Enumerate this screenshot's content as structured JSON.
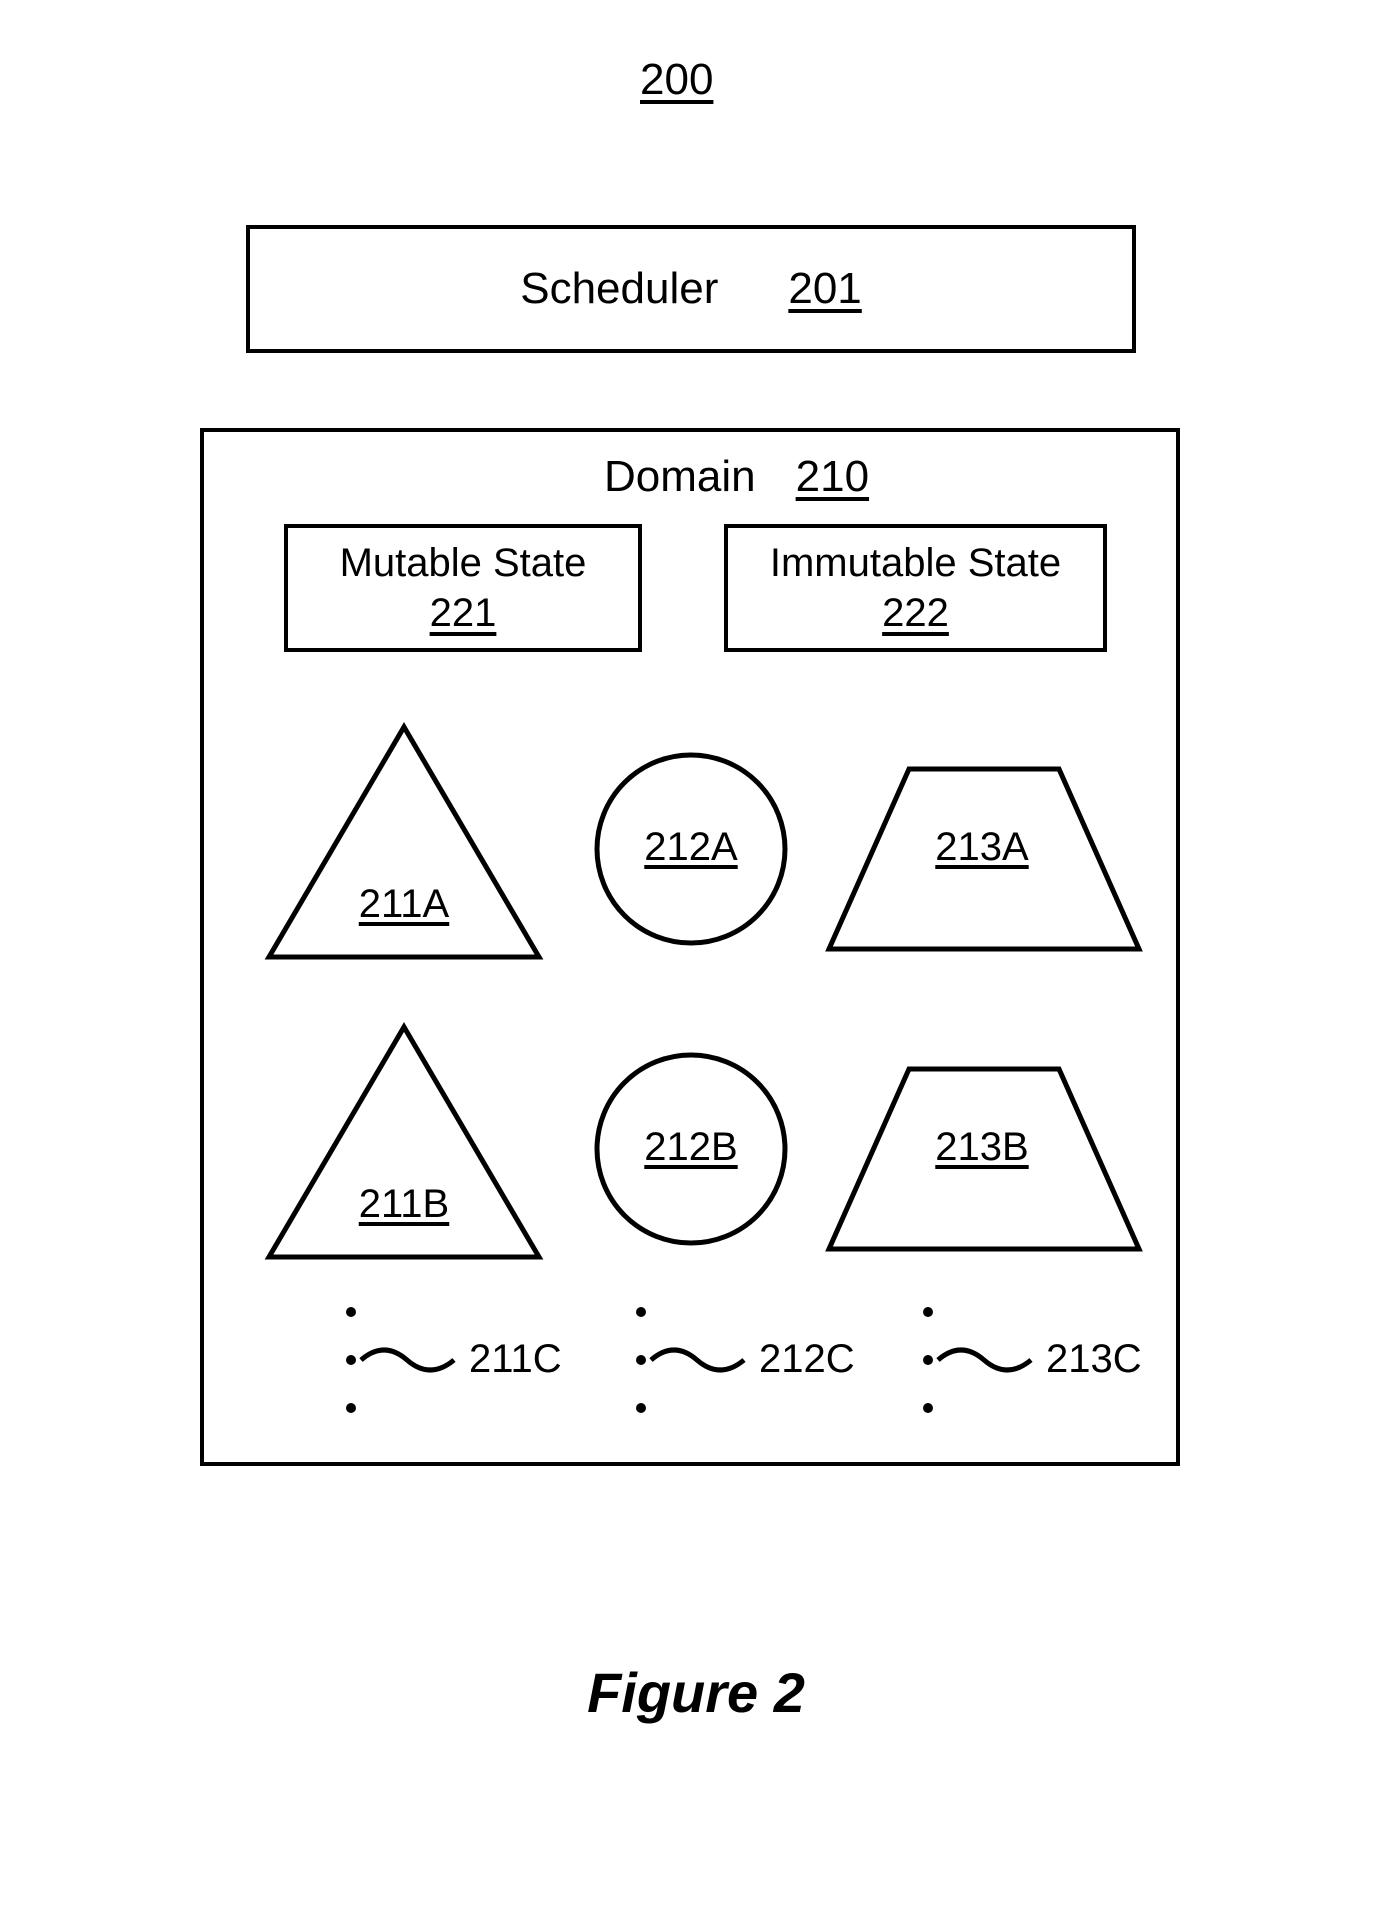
{
  "figure_number": "200",
  "scheduler": {
    "label": "Scheduler",
    "ref": "201"
  },
  "domain": {
    "label": "Domain",
    "ref": "210",
    "mutable_state": {
      "label": "Mutable State",
      "ref": "221"
    },
    "immutable_state": {
      "label": "Immutable State",
      "ref": "222"
    },
    "shapes": {
      "triangle_a": "211A",
      "triangle_b": "211B",
      "triangle_c": "211C",
      "circle_a": "212A",
      "circle_b": "212B",
      "circle_c": "212C",
      "trapezoid_a": "213A",
      "trapezoid_b": "213B",
      "trapezoid_c": "213C"
    }
  },
  "caption": "Figure 2"
}
